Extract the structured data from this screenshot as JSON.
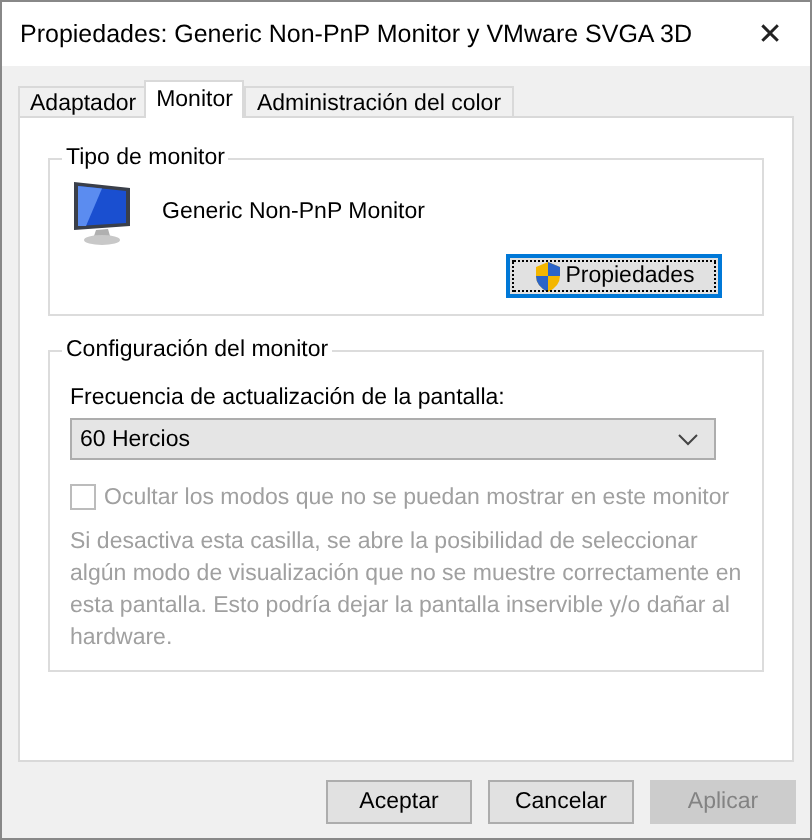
{
  "window": {
    "title": "Propiedades: Generic Non-PnP Monitor y VMware SVGA 3D",
    "close": "✕"
  },
  "tabs": [
    {
      "label": "Adaptador",
      "selected": false
    },
    {
      "label": "Monitor",
      "selected": true
    },
    {
      "label": "Administración del color",
      "selected": false
    }
  ],
  "monitor_type": {
    "title": "Tipo de monitor",
    "device": "Generic Non-PnP Monitor",
    "properties_button": "Propiedades"
  },
  "monitor_settings": {
    "title": "Configuración del monitor",
    "refresh_label": "Frecuencia de actualización de la pantalla:",
    "refresh_rate": "60 Hercios",
    "hide_modes": {
      "label": "Ocultar los modos que no se puedan mostrar en este monitor",
      "checked": false,
      "disabled": true
    },
    "description": "Si desactiva esta casilla, se abre la posibilidad de seleccionar algún modo de visualización que no se muestre correctamente en esta pantalla. Esto podría dejar la pantalla inservible y/o dañar al hardware."
  },
  "buttons": [
    {
      "label": "Aceptar",
      "disabled": false
    },
    {
      "label": "Cancelar",
      "disabled": false
    },
    {
      "label": "Aplicar",
      "disabled": true
    }
  ]
}
